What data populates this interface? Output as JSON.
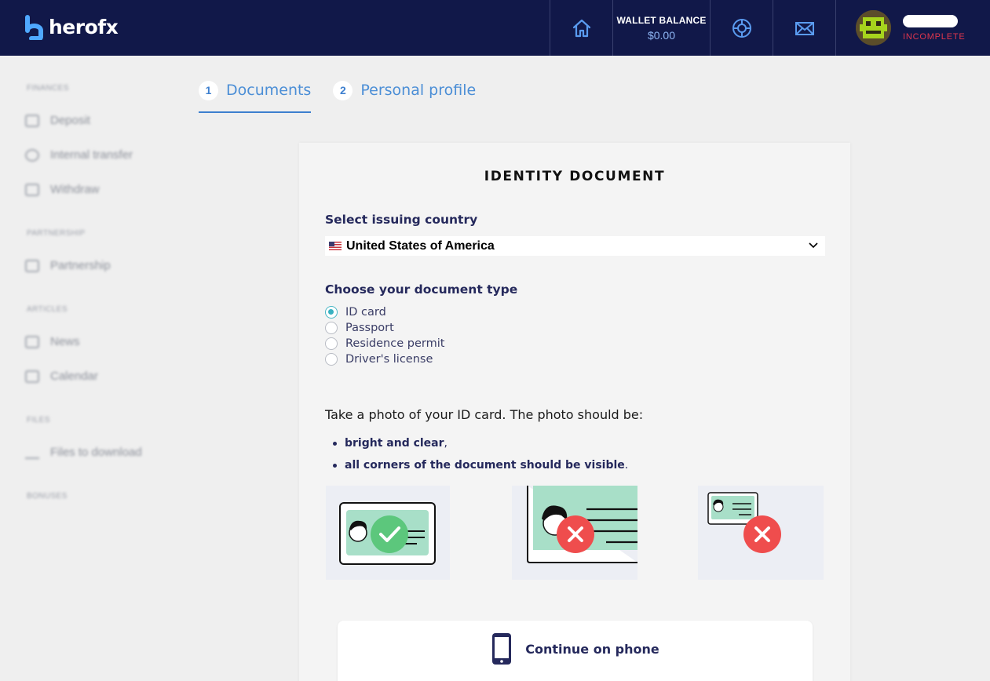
{
  "header": {
    "logo_text": "herofx",
    "wallet_label": "WALLET BALANCE",
    "wallet_value": "$0.00",
    "user_status": "INCOMPLETE",
    "icons": [
      "home-icon",
      "lifebuoy-icon",
      "mail-icon"
    ]
  },
  "sidebar": {
    "sections": [
      {
        "title": "FINANCES",
        "items": [
          "Deposit",
          "Internal transfer",
          "Withdraw"
        ]
      },
      {
        "title": "PARTNERSHIP",
        "items": [
          "Partnership"
        ]
      },
      {
        "title": "ARTICLES",
        "items": [
          "News",
          "Calendar"
        ]
      },
      {
        "title": "FILES",
        "items": [
          "Files to download"
        ]
      },
      {
        "title": "BONUSES",
        "items": []
      }
    ]
  },
  "steps": [
    {
      "number": "1",
      "label": "Documents",
      "active": true
    },
    {
      "number": "2",
      "label": "Personal profile",
      "active": false
    }
  ],
  "card": {
    "title": "IDENTITY DOCUMENT",
    "country_label": "Select issuing country",
    "country_value": "United States of America",
    "doc_type_label": "Choose your document type",
    "doc_types": [
      {
        "label": "ID card",
        "checked": true
      },
      {
        "label": "Passport",
        "checked": false
      },
      {
        "label": "Residence permit",
        "checked": false
      },
      {
        "label": "Driver's license",
        "checked": false
      }
    ],
    "instructions": "Take a photo of your ID card. The photo should be:",
    "requirements": [
      {
        "bold": "bright and clear",
        "suffix": ","
      },
      {
        "bold": "all corners of the document should be visible",
        "suffix": "."
      }
    ],
    "continue_phone_label": "Continue on phone"
  },
  "colors": {
    "topbar": "#111849",
    "accent": "#3d7fcf",
    "status_incomplete": "#e0364d",
    "ok_green": "#5cc77c",
    "error_red": "#ef4d4d"
  }
}
